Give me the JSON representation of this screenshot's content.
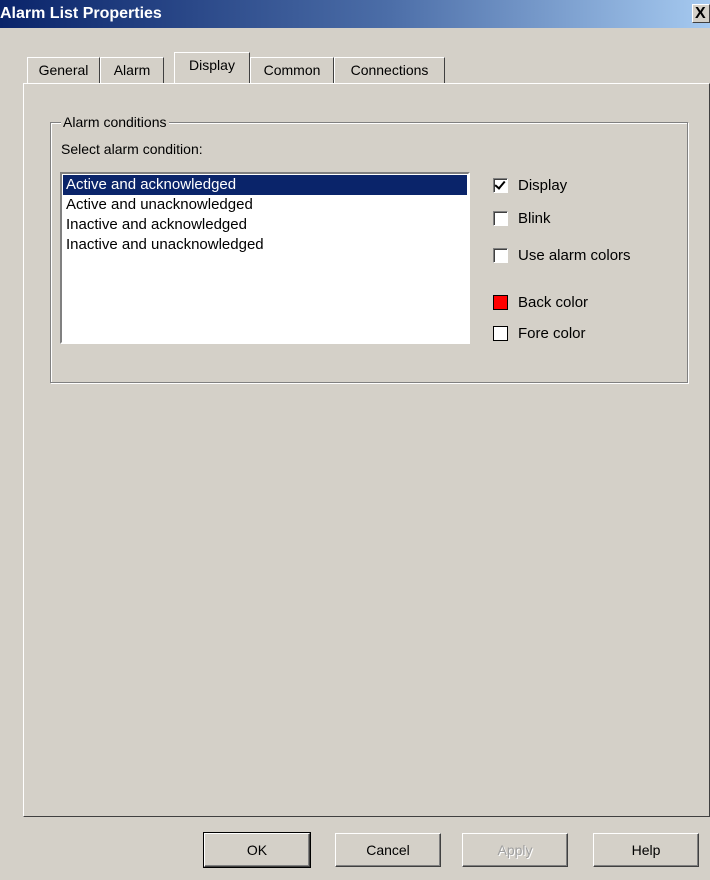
{
  "window": {
    "title": "Alarm List Properties",
    "close_label": "X"
  },
  "tabs": [
    {
      "label": "General",
      "active": false
    },
    {
      "label": "Alarm",
      "active": false
    },
    {
      "label": "Display",
      "active": true
    },
    {
      "label": "Common",
      "active": false
    },
    {
      "label": "Connections",
      "active": false
    }
  ],
  "alarm_conditions": {
    "legend": "Alarm conditions",
    "select_label": "Select alarm condition:",
    "items": [
      "Active and acknowledged",
      "Active and unacknowledged",
      "Inactive and acknowledged",
      "Inactive and unacknowledged"
    ],
    "selected_index": 0
  },
  "options": {
    "display": {
      "label": "Display",
      "checked": true
    },
    "blink": {
      "label": "Blink",
      "checked": false
    },
    "use_alarm_colors": {
      "label": "Use alarm colors",
      "checked": false
    },
    "back_color": {
      "label": "Back color",
      "color": "#ff0000"
    },
    "fore_color": {
      "label": "Fore color",
      "color": "#ffffff"
    }
  },
  "buttons": {
    "ok": "OK",
    "cancel": "Cancel",
    "apply": "Apply",
    "help": "Help"
  }
}
